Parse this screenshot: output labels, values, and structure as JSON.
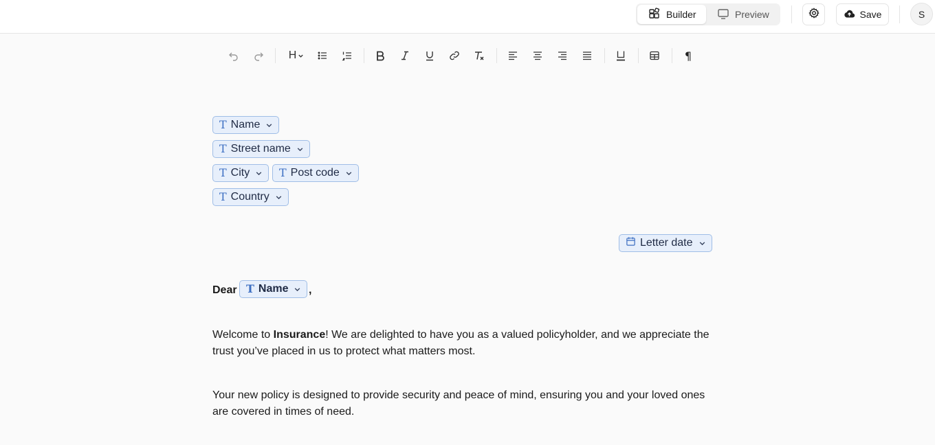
{
  "header": {
    "builder_label": "Builder",
    "preview_label": "Preview",
    "save_label": "Save",
    "avatar_initial": "S"
  },
  "toolbar": {
    "heading_label": "H",
    "paragraph_mark": "¶"
  },
  "fields": {
    "name": "Name",
    "street_name": "Street name",
    "city": "City",
    "post_code": "Post code",
    "country": "Country",
    "letter_date": "Letter date",
    "greeting_name": "Name"
  },
  "letter": {
    "dear": "Dear",
    "greeting_comma": ",",
    "p1_before": "Welcome to ",
    "p1_bold": "Insurance",
    "p1_after": "! We are delighted to have you as a valued policyholder, and we appreciate the trust you’ve placed in us to protect what matters most.",
    "p2": "Your new policy is designed to provide security and peace of mind, ensuring you and your loved ones are covered in times of need."
  },
  "colors": {
    "chip_bg": "#e7effb",
    "chip_border": "#9fbde6",
    "chip_icon": "#3d6fc2"
  }
}
